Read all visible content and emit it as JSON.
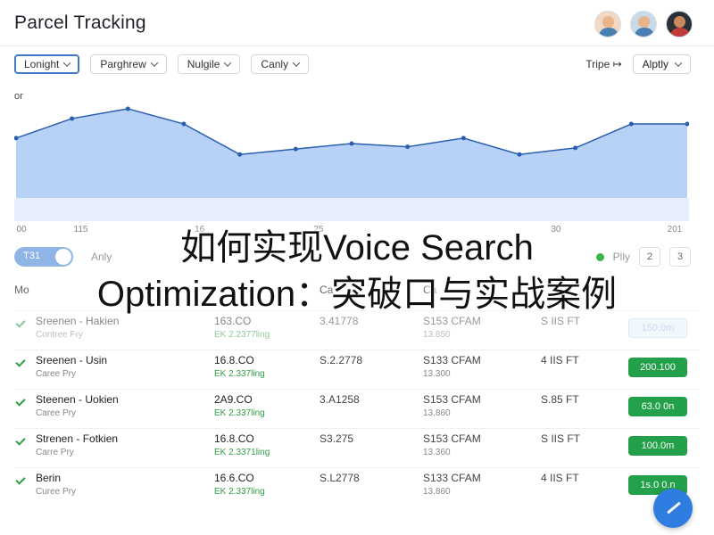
{
  "header": {
    "title": "Parcel Tracking"
  },
  "filters": [
    {
      "label": "Lonight",
      "active": true
    },
    {
      "label": "Parghrew",
      "active": false
    },
    {
      "label": "Nulgile",
      "active": false
    },
    {
      "label": "Canly",
      "active": false
    }
  ],
  "right_controls": {
    "tripe_label": "Tripe",
    "tripe_arrow": "↦",
    "apply_label": "Alptly"
  },
  "chart_data": {
    "type": "area",
    "ylabel": "or",
    "x_tick_labels": [
      "00",
      "115",
      "",
      "16",
      "",
      "25",
      "",
      "",
      "",
      "30",
      "",
      "201"
    ],
    "values": [
      55,
      73,
      82,
      68,
      40,
      45,
      50,
      47,
      55,
      40,
      46,
      68,
      68
    ],
    "ylim": [
      0,
      100
    ],
    "fill_color": "#b8d1f7",
    "line_color": "#2a5fb0"
  },
  "toolbar": {
    "toggle_label": "T31",
    "toggle_text": "Anly",
    "page_label": "Plly",
    "page_buttons": [
      "2",
      "3"
    ]
  },
  "table": {
    "headers": [
      "Mo",
      "Ca",
      "Ca"
    ],
    "rows": [
      {
        "name": "Sreenen - Hakien",
        "sub": "Contree Fry",
        "amount": "163.CO",
        "amount_sub": "EK 2.2377ling",
        "weight": "3.41778",
        "carrier": "S153 CFAM",
        "carrier_sub": "13.850",
        "distance": "S IIS FT",
        "status": "150.0m",
        "pale": true
      },
      {
        "name": "Sreenen - Usin",
        "sub": "Caree Pry",
        "amount": "16.8.CO",
        "amount_sub": "EK 2.337ling",
        "weight": "S.2.2778",
        "carrier": "S133 CFAM",
        "carrier_sub": "13.300",
        "distance": "4 IIS FT",
        "status": "200.100",
        "pale": false
      },
      {
        "name": "Steenen - Uokien",
        "sub": "Caree Pry",
        "amount": "2A9.CO",
        "amount_sub": "EK 2.337ling",
        "weight": "3.A1258",
        "carrier": "S153 CFAM",
        "carrier_sub": "13.860",
        "distance": "S.85 FT",
        "status": "63.0 0n",
        "pale": false
      },
      {
        "name": "Strenen - Fotkien",
        "sub": "Carre Pry",
        "amount": "16.8.CO",
        "amount_sub": "EK 2.3371ling",
        "weight": "S3.275",
        "carrier": "S153 CFAM",
        "carrier_sub": "13.360",
        "distance": "S IIS FT",
        "status": "100.0m",
        "pale": false
      },
      {
        "name": "Berin",
        "sub": "Curee Pry",
        "amount": "16.6.CO",
        "amount_sub": "EK 2.337ling",
        "weight": "S.L2778",
        "carrier": "S133 CFAM",
        "carrier_sub": "13.860",
        "distance": "4 IIS FT",
        "status": "1s.0 0.n",
        "pale": false
      }
    ]
  },
  "overlay": {
    "line1": "如何实现Voice Search",
    "line2": "Optimization：突破口与实战案例"
  }
}
